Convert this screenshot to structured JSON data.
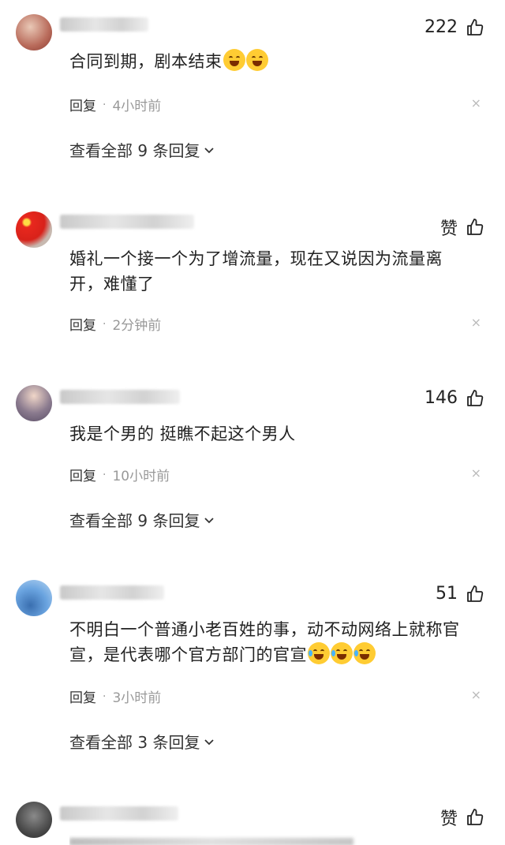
{
  "labels": {
    "reply": "回复",
    "dot": "·",
    "close": "×"
  },
  "comments": [
    {
      "likes": "222",
      "text_parts": [
        "合同到期，剧本结束"
      ],
      "time": "4小时前",
      "expand": "查看全部 9 条回复"
    },
    {
      "likes": "赞",
      "text_parts": [
        "婚礼一个接一个为了增流量，现在又说因为流量离开，难懂了"
      ],
      "time": "2分钟前"
    },
    {
      "likes": "146",
      "text_parts": [
        "我是个男的 挺瞧不起这个男人"
      ],
      "time": "10小时前",
      "expand": "查看全部 9 条回复"
    },
    {
      "likes": "51",
      "text_parts": [
        "不明白一个普通小老百姓的事，动不动网络上就称官宣，是代表哪个官方部门的官宣"
      ],
      "time": "3小时前",
      "expand": "查看全部 3 条回复"
    },
    {
      "likes": "赞",
      "text_parts": [
        ""
      ]
    }
  ],
  "colors": {
    "text": "#222222",
    "muted": "#999999",
    "emoji": "#ffcc33"
  },
  "icons": [
    "thumbs-up-icon",
    "chevron-down-icon",
    "close-icon",
    "laughing-emoji-icon",
    "crying-laughing-emoji-icon"
  ]
}
